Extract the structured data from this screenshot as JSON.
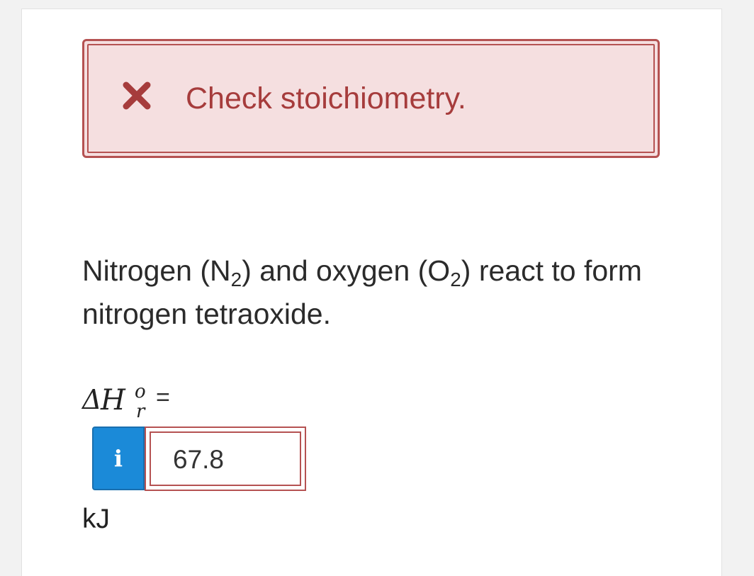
{
  "feedback": {
    "icon": "close-icon",
    "message": "Check stoichiometry.",
    "color": "#a63c3c"
  },
  "question": {
    "text_before_n2": "Nitrogen (N",
    "n2_subscript": "2",
    "text_between": ") and oxygen (O",
    "o2_subscript": "2",
    "text_after": ") react to form nitrogen tetraoxide."
  },
  "answer": {
    "label_delta": "Δ",
    "label_H": "H",
    "label_superscript": "o",
    "label_subscript": "r",
    "equals": "=",
    "info_icon_glyph": "i",
    "value": "67.8",
    "unit": "kJ"
  },
  "colors": {
    "error_border": "#b55252",
    "error_background": "#f5dfe0",
    "info_button": "#1b8ad8"
  }
}
